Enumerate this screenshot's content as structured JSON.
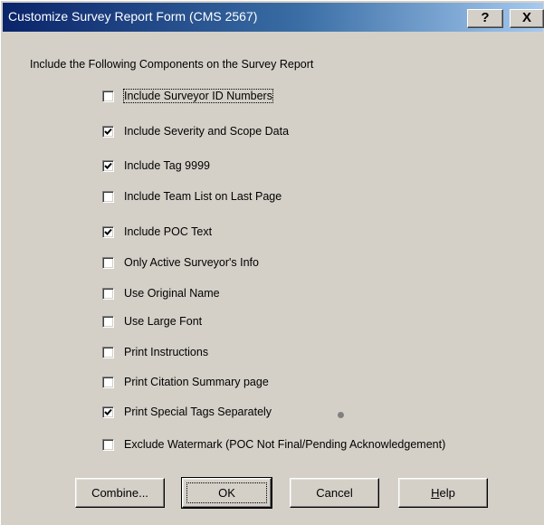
{
  "window": {
    "title": "Customize Survey Report Form (CMS 2567)",
    "help_button": "?",
    "close_button": "X"
  },
  "intro": "Include the Following Components on the Survey Report",
  "options": [
    {
      "label": "Include Surveyor ID Numbers",
      "checked": false,
      "focused": true
    },
    {
      "label": "Include Severity and Scope Data",
      "checked": true
    },
    {
      "label": "Include Tag 9999",
      "checked": true
    },
    {
      "label": "Include Team List on Last Page",
      "checked": false
    },
    {
      "label": "Include POC Text",
      "checked": true
    },
    {
      "label": "Only Active Surveyor's Info",
      "checked": false
    },
    {
      "label": "Use Original Name",
      "checked": false
    },
    {
      "label": "Use Large Font",
      "checked": false
    },
    {
      "label": "Print Instructions",
      "checked": false
    },
    {
      "label": "Print Citation Summary page",
      "checked": false
    },
    {
      "label": "Print Special Tags Separately",
      "checked": true
    },
    {
      "label": "Exclude Watermark (POC Not Final/Pending Acknowledgement)",
      "checked": false
    }
  ],
  "buttons": {
    "combine": "Combine...",
    "ok": "OK",
    "cancel": "Cancel",
    "help_prefix": "",
    "help_hotkey": "H",
    "help_rest": "elp"
  }
}
